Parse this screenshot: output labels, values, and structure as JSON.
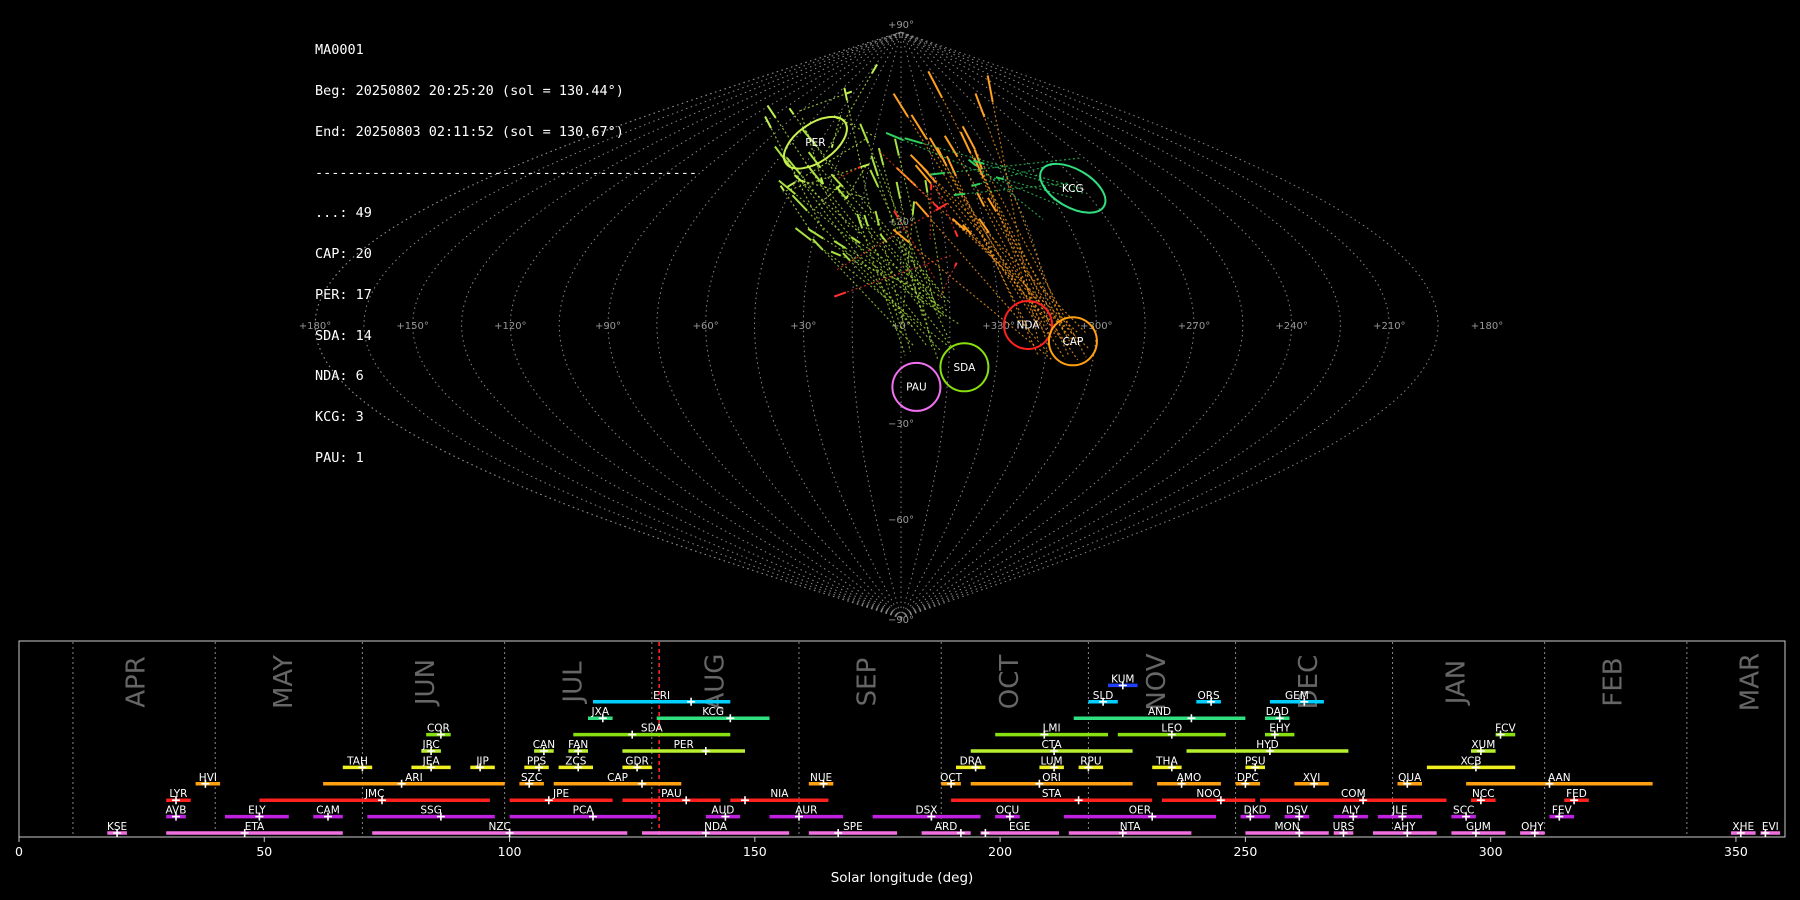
{
  "header": {
    "camera": "MA0001",
    "begin": "Beg: 20250802 20:25:20 (sol = 130.44°)",
    "end": "End: 20250803 02:11:52 (sol = 130.67°)",
    "separator": "-----------------------------------------------",
    "counts": [
      "...: 49",
      "CAP: 20",
      "PER: 17",
      "SDA: 14",
      "NDA: 6",
      "KCG: 3",
      "PAU: 1"
    ]
  },
  "chart_data": [
    {
      "type": "scatter",
      "projection": "sinusoidal",
      "grid": true,
      "longitude_ticks": [
        "+180°",
        "+150°",
        "+120°",
        "+90°",
        "+60°",
        "+30°",
        "+0°",
        "+330°",
        "+300°",
        "+270°",
        "+240°",
        "+210°",
        "+180°"
      ],
      "latitude_ticks": [
        "+90°",
        "+30°",
        "−30°",
        "−60°",
        "−90°"
      ],
      "radiants": [
        {
          "code": "PER",
          "lon": 47,
          "lat": 56,
          "color": "#c8f050"
        },
        {
          "code": "KCG",
          "lon": 289,
          "lat": 42,
          "color": "#30e080"
        },
        {
          "code": "NDA",
          "lon": 321,
          "lat": 0,
          "color": "#ff2020"
        },
        {
          "code": "CAP",
          "lon": 307,
          "lat": -5,
          "color": "#ffa010"
        },
        {
          "code": "SDA",
          "lon": 340,
          "lat": -13,
          "color": "#88e010"
        },
        {
          "code": "PAU",
          "lon": 355,
          "lat": -19,
          "color": "#f070f0"
        }
      ]
    },
    {
      "type": "gantt",
      "xlabel": "Solar longitude (deg)",
      "xlim": [
        0,
        360
      ],
      "xticks": [
        "0",
        "50",
        "100",
        "150",
        "200",
        "250",
        "300",
        "350"
      ],
      "current_sol": 130.5,
      "months": [
        {
          "name": "APR",
          "pos": 24
        },
        {
          "name": "MAY",
          "pos": 54
        },
        {
          "name": "JUN",
          "pos": 83
        },
        {
          "name": "JUL",
          "pos": 113
        },
        {
          "name": "AUG",
          "pos": 142
        },
        {
          "name": "SEP",
          "pos": 173
        },
        {
          "name": "OCT",
          "pos": 202
        },
        {
          "name": "NOV",
          "pos": 232
        },
        {
          "name": "DEC",
          "pos": 263
        },
        {
          "name": "JAN",
          "pos": 293
        },
        {
          "name": "FEB",
          "pos": 325
        },
        {
          "name": "MAR",
          "pos": 353
        }
      ],
      "month_lines": [
        11,
        40,
        70,
        99,
        129,
        159,
        188,
        218,
        248,
        280,
        311,
        340
      ],
      "showers": [
        {
          "code": "KUM",
          "start": 222,
          "end": 228,
          "peak": 225,
          "row": 9,
          "color": "#2040ff"
        },
        {
          "code": "ERI",
          "start": 117,
          "end": 145,
          "peak": 137,
          "row": 8,
          "color": "#00d0ff"
        },
        {
          "code": "SLD",
          "start": 218,
          "end": 224,
          "peak": 221,
          "row": 8,
          "color": "#00d0ff"
        },
        {
          "code": "ORS",
          "start": 240,
          "end": 245,
          "peak": 243,
          "row": 8,
          "color": "#00d0ff"
        },
        {
          "code": "GEM",
          "start": 255,
          "end": 266,
          "peak": 262,
          "row": 8,
          "color": "#00d0ff"
        },
        {
          "code": "JXA",
          "start": 116,
          "end": 121,
          "peak": 119,
          "row": 7,
          "color": "#30e080"
        },
        {
          "code": "KCG",
          "start": 130,
          "end": 153,
          "peak": 145,
          "row": 7,
          "color": "#30e080"
        },
        {
          "code": "AND",
          "start": 215,
          "end": 250,
          "peak": 239,
          "row": 7,
          "color": "#30e080"
        },
        {
          "code": "DAD",
          "start": 254,
          "end": 259,
          "peak": 257,
          "row": 7,
          "color": "#30e080"
        },
        {
          "code": "COR",
          "start": 83,
          "end": 88,
          "peak": 86,
          "row": 6,
          "color": "#88e010"
        },
        {
          "code": "SDA",
          "start": 113,
          "end": 145,
          "peak": 125,
          "row": 6,
          "color": "#88e010"
        },
        {
          "code": "LMI",
          "start": 199,
          "end": 222,
          "peak": 209,
          "row": 6,
          "color": "#88e010"
        },
        {
          "code": "LEO",
          "start": 224,
          "end": 246,
          "peak": 235,
          "row": 6,
          "color": "#88e010"
        },
        {
          "code": "EHY",
          "start": 254,
          "end": 260,
          "peak": 256,
          "row": 6,
          "color": "#88e010"
        },
        {
          "code": "FCV",
          "start": 301,
          "end": 305,
          "peak": 302,
          "row": 6,
          "color": "#88e010"
        },
        {
          "code": "JRC",
          "start": 82,
          "end": 86,
          "peak": 84,
          "row": 5,
          "color": "#b8f030"
        },
        {
          "code": "CAN",
          "start": 105,
          "end": 109,
          "peak": 107,
          "row": 5,
          "color": "#b8f030"
        },
        {
          "code": "FAN",
          "start": 112,
          "end": 116,
          "peak": 114,
          "row": 5,
          "color": "#b8f030"
        },
        {
          "code": "PER",
          "start": 123,
          "end": 148,
          "peak": 140,
          "row": 5,
          "color": "#b8f030"
        },
        {
          "code": "CTA",
          "start": 194,
          "end": 227,
          "peak": 211,
          "row": 5,
          "color": "#b8f030"
        },
        {
          "code": "HYD",
          "start": 238,
          "end": 271,
          "peak": 255,
          "row": 5,
          "color": "#b8f030"
        },
        {
          "code": "XUM",
          "start": 296,
          "end": 301,
          "peak": 298,
          "row": 5,
          "color": "#b8f030"
        },
        {
          "code": "TAH",
          "start": 66,
          "end": 72,
          "peak": 70,
          "row": 4,
          "color": "#f0f020"
        },
        {
          "code": "JEA",
          "start": 80,
          "end": 88,
          "peak": 84,
          "row": 4,
          "color": "#f0f020"
        },
        {
          "code": "JIP",
          "start": 92,
          "end": 97,
          "peak": 94,
          "row": 4,
          "color": "#f0f020"
        },
        {
          "code": "PPS",
          "start": 103,
          "end": 108,
          "peak": 106,
          "row": 4,
          "color": "#f0f020"
        },
        {
          "code": "ZCS",
          "start": 110,
          "end": 117,
          "peak": 114,
          "row": 4,
          "color": "#f0f020"
        },
        {
          "code": "GDR",
          "start": 123,
          "end": 129,
          "peak": 126,
          "row": 4,
          "color": "#f0f020"
        },
        {
          "code": "DRA",
          "start": 191,
          "end": 197,
          "peak": 195,
          "row": 4,
          "color": "#f0f020"
        },
        {
          "code": "LUM",
          "start": 208,
          "end": 213,
          "peak": 211,
          "row": 4,
          "color": "#f0f020"
        },
        {
          "code": "RPU",
          "start": 216,
          "end": 221,
          "peak": 218,
          "row": 4,
          "color": "#f0f020"
        },
        {
          "code": "THA",
          "start": 231,
          "end": 237,
          "peak": 235,
          "row": 4,
          "color": "#f0f020"
        },
        {
          "code": "PSU",
          "start": 250,
          "end": 254,
          "peak": 252,
          "row": 4,
          "color": "#f0f020"
        },
        {
          "code": "XCB",
          "start": 287,
          "end": 305,
          "peak": 297,
          "row": 4,
          "color": "#f0f020"
        },
        {
          "code": "HVI",
          "start": 36,
          "end": 41,
          "peak": 38,
          "row": 3,
          "color": "#ffa010"
        },
        {
          "code": "ARI",
          "start": 62,
          "end": 99,
          "peak": 78,
          "row": 3,
          "color": "#ffa010"
        },
        {
          "code": "SZC",
          "start": 102,
          "end": 107,
          "peak": 104,
          "row": 3,
          "color": "#ffa010"
        },
        {
          "code": "CAP",
          "start": 109,
          "end": 135,
          "peak": 127,
          "row": 3,
          "color": "#ffa010"
        },
        {
          "code": "NUE",
          "start": 161,
          "end": 166,
          "peak": 164,
          "row": 3,
          "color": "#ffa010"
        },
        {
          "code": "OCT",
          "start": 188,
          "end": 192,
          "peak": 190,
          "row": 3,
          "color": "#ffa010"
        },
        {
          "code": "ORI",
          "start": 194,
          "end": 227,
          "peak": 208,
          "row": 3,
          "color": "#ffa010"
        },
        {
          "code": "AMO",
          "start": 232,
          "end": 245,
          "peak": 237,
          "row": 3,
          "color": "#ffa010"
        },
        {
          "code": "DPC",
          "start": 248,
          "end": 253,
          "peak": 250,
          "row": 3,
          "color": "#ffa010"
        },
        {
          "code": "XVI",
          "start": 260,
          "end": 267,
          "peak": 264,
          "row": 3,
          "color": "#ffa010"
        },
        {
          "code": "QUA",
          "start": 281,
          "end": 286,
          "peak": 283,
          "row": 3,
          "color": "#ffa010"
        },
        {
          "code": "AAN",
          "start": 295,
          "end": 333,
          "peak": 312,
          "row": 3,
          "color": "#ffa010"
        },
        {
          "code": "LYR",
          "start": 30,
          "end": 35,
          "peak": 32,
          "row": 2,
          "color": "#ff2020"
        },
        {
          "code": "JMC",
          "start": 49,
          "end": 96,
          "peak": 74,
          "row": 2,
          "color": "#ff2020"
        },
        {
          "code": "JPE",
          "start": 100,
          "end": 121,
          "peak": 108,
          "row": 2,
          "color": "#ff2020"
        },
        {
          "code": "PAU",
          "start": 123,
          "end": 143,
          "peak": 136,
          "row": 2,
          "color": "#ff2020"
        },
        {
          "code": "NIA",
          "start": 145,
          "end": 165,
          "peak": 148,
          "row": 2,
          "color": "#ff2020"
        },
        {
          "code": "STA",
          "start": 190,
          "end": 231,
          "peak": 216,
          "row": 2,
          "color": "#ff2020"
        },
        {
          "code": "NOO",
          "start": 233,
          "end": 252,
          "peak": 245,
          "row": 2,
          "color": "#ff2020"
        },
        {
          "code": "COM",
          "start": 253,
          "end": 291,
          "peak": 274,
          "row": 2,
          "color": "#ff2020"
        },
        {
          "code": "NCC",
          "start": 296,
          "end": 301,
          "peak": 298,
          "row": 2,
          "color": "#ff2020"
        },
        {
          "code": "FED",
          "start": 315,
          "end": 320,
          "peak": 317,
          "row": 2,
          "color": "#ff2020"
        },
        {
          "code": "AVB",
          "start": 30,
          "end": 34,
          "peak": 32,
          "row": 1,
          "color": "#c020e0"
        },
        {
          "code": "ELY",
          "start": 42,
          "end": 55,
          "peak": 49,
          "row": 1,
          "color": "#c020e0"
        },
        {
          "code": "CAM",
          "start": 60,
          "end": 66,
          "peak": 63,
          "row": 1,
          "color": "#c020e0"
        },
        {
          "code": "SSG",
          "start": 71,
          "end": 97,
          "peak": 86,
          "row": 1,
          "color": "#c020e0"
        },
        {
          "code": "PCA",
          "start": 100,
          "end": 130,
          "peak": 117,
          "row": 1,
          "color": "#c020e0"
        },
        {
          "code": "AUD",
          "start": 140,
          "end": 147,
          "peak": 144,
          "row": 1,
          "color": "#c020e0"
        },
        {
          "code": "AUR",
          "start": 153,
          "end": 168,
          "peak": 159,
          "row": 1,
          "color": "#c020e0"
        },
        {
          "code": "DSX",
          "start": 174,
          "end": 196,
          "peak": 186,
          "row": 1,
          "color": "#c020e0"
        },
        {
          "code": "OCU",
          "start": 199,
          "end": 204,
          "peak": 202,
          "row": 1,
          "color": "#c020e0"
        },
        {
          "code": "OER",
          "start": 213,
          "end": 244,
          "peak": 231,
          "row": 1,
          "color": "#c020e0"
        },
        {
          "code": "DKD",
          "start": 249,
          "end": 255,
          "peak": 251,
          "row": 1,
          "color": "#c020e0"
        },
        {
          "code": "DSV",
          "start": 258,
          "end": 263,
          "peak": 261,
          "row": 1,
          "color": "#c020e0"
        },
        {
          "code": "ALY",
          "start": 268,
          "end": 275,
          "peak": 272,
          "row": 1,
          "color": "#c020e0"
        },
        {
          "code": "JLE",
          "start": 277,
          "end": 286,
          "peak": 282,
          "row": 1,
          "color": "#c020e0"
        },
        {
          "code": "SCC",
          "start": 292,
          "end": 297,
          "peak": 295,
          "row": 1,
          "color": "#c020e0"
        },
        {
          "code": "FEV",
          "start": 312,
          "end": 317,
          "peak": 314,
          "row": 1,
          "color": "#c020e0"
        },
        {
          "code": "KSE",
          "start": 18,
          "end": 22,
          "peak": 20,
          "row": 0,
          "color": "#f070e0"
        },
        {
          "code": "ETA",
          "start": 30,
          "end": 66,
          "peak": 46,
          "row": 0,
          "color": "#f070e0"
        },
        {
          "code": "NZC",
          "start": 72,
          "end": 124,
          "peak": 100,
          "row": 0,
          "color": "#f070e0"
        },
        {
          "code": "NDA",
          "start": 127,
          "end": 157,
          "peak": 140,
          "row": 0,
          "color": "#f070e0"
        },
        {
          "code": "SPE",
          "start": 161,
          "end": 179,
          "peak": 167,
          "row": 0,
          "color": "#f070e0"
        },
        {
          "code": "ARD",
          "start": 184,
          "end": 194,
          "peak": 192,
          "row": 0,
          "color": "#f070e0"
        },
        {
          "code": "EGE",
          "start": 196,
          "end": 212,
          "peak": 197,
          "row": 0,
          "color": "#f070e0"
        },
        {
          "code": "NTA",
          "start": 214,
          "end": 239,
          "peak": 225,
          "row": 0,
          "color": "#f070e0"
        },
        {
          "code": "MON",
          "start": 250,
          "end": 267,
          "peak": 261,
          "row": 0,
          "color": "#f070e0"
        },
        {
          "code": "URS",
          "start": 268,
          "end": 272,
          "peak": 270,
          "row": 0,
          "color": "#f070e0"
        },
        {
          "code": "AHY",
          "start": 276,
          "end": 289,
          "peak": 283,
          "row": 0,
          "color": "#f070e0"
        },
        {
          "code": "GUM",
          "start": 292,
          "end": 303,
          "peak": 297,
          "row": 0,
          "color": "#f070e0"
        },
        {
          "code": "OHY",
          "start": 306,
          "end": 311,
          "peak": 309,
          "row": 0,
          "color": "#f070e0"
        },
        {
          "code": "XHE",
          "start": 349,
          "end": 354,
          "peak": 351,
          "row": 0,
          "color": "#f070e0"
        },
        {
          "code": "EVI",
          "start": 355,
          "end": 359,
          "peak": 356,
          "row": 0,
          "color": "#f070e0"
        }
      ]
    }
  ]
}
